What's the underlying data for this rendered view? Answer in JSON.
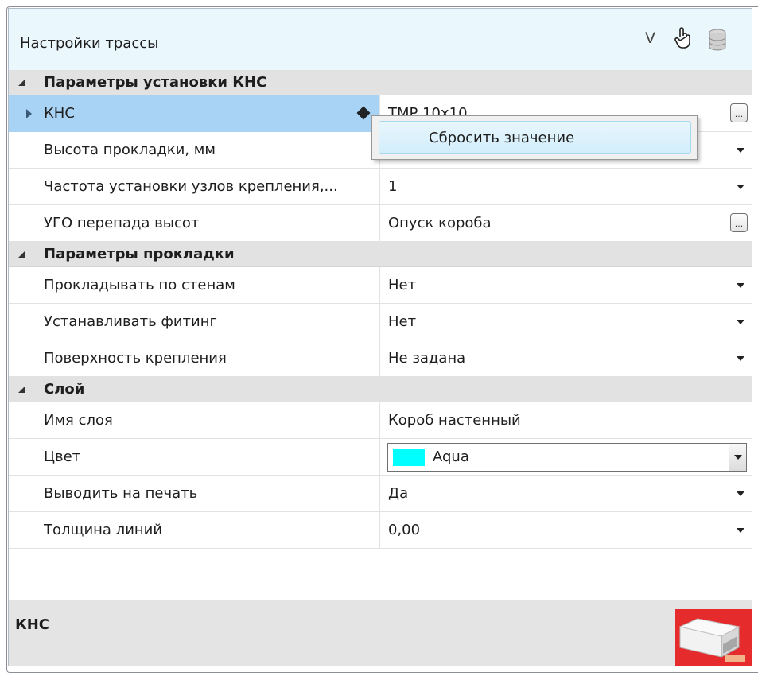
{
  "header": {
    "title": "Настройки трассы",
    "v_label": "V",
    "icons": [
      "hand-pointer-icon",
      "database-icon"
    ]
  },
  "categories": [
    {
      "label": "Параметры установки КНС",
      "rows": [
        {
          "name": "КНС",
          "value": "ТМР 10х10",
          "editor": "ellipsis",
          "selected": true
        },
        {
          "name": "Высота прокладки, мм",
          "value": "",
          "editor": "dropdown"
        },
        {
          "name": "Частота установки узлов крепления,...",
          "value": "1",
          "editor": "dropdown"
        },
        {
          "name": "УГО перепада высот",
          "value": "Опуск короба",
          "editor": "ellipsis"
        }
      ]
    },
    {
      "label": "Параметры прокладки",
      "rows": [
        {
          "name": "Прокладывать по стенам",
          "value": "Нет",
          "editor": "dropdown"
        },
        {
          "name": "Устанавливать фитинг",
          "value": "Нет",
          "editor": "dropdown"
        },
        {
          "name": "Поверхность крепления",
          "value": "Не задана",
          "editor": "dropdown"
        }
      ]
    },
    {
      "label": "Слой",
      "rows": [
        {
          "name": "Имя слоя",
          "value": "Короб настенный",
          "editor": "none"
        },
        {
          "name": "Цвет",
          "value": "Aqua",
          "editor": "color-combo",
          "swatch_color": "#00ffff"
        },
        {
          "name": "Выводить на печать",
          "value": "Да",
          "editor": "dropdown"
        },
        {
          "name": "Толщина линий",
          "value": "0,00",
          "editor": "dropdown"
        }
      ]
    }
  ],
  "context_menu": {
    "items": [
      {
        "label": "Сбросить значение"
      }
    ]
  },
  "description": {
    "title": "КНС",
    "image_icon": "cable-tray-image"
  },
  "colors": {
    "header_bg": "#eaf7fc",
    "selection": "#a9d3f5",
    "category_bg": "#e2e2e2",
    "accent_red": "#e52b2b"
  }
}
